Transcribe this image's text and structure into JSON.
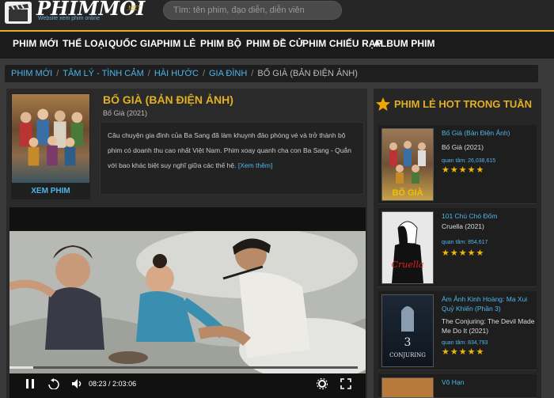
{
  "header": {
    "logo_text": "PHIMMOI",
    "logo_tagline": "Website xem phim online",
    "logo_tld": ".NET",
    "search_placeholder": "Tìm: tên phim, đạo diễn, diễn viên"
  },
  "nav": [
    "PHIM MỚI",
    "THỂ LOẠI",
    "QUỐC GIA",
    "PHIM LẺ",
    "PHIM BỘ",
    "PHIM ĐỀ CỬ",
    "PHIM CHIẾU RẠP",
    "ALBUM PHIM"
  ],
  "breadcrumb": {
    "links": [
      "PHIM MỚI",
      "TÂM LÝ - TÌNH CẢM",
      "HÀI HƯỚC",
      "GIA ĐÌNH"
    ],
    "current": "BỐ GIÀ (BẢN ĐIỆN ẢNH)"
  },
  "movie": {
    "title": "BỐ GIÀ (BẢN ĐIỆN ẢNH)",
    "subtitle": "Bố Già (2021)",
    "description": "Câu chuyện gia đình của Ba Sang đã làm khuynh đảo phòng vé và trở thành bộ phim có doanh thu cao nhất Việt Nam. Phim xoay quanh cha con Ba Sang - Quắn với bao khác biệt suy nghĩ giữa các thế hệ.",
    "more_label": "[Xem thêm]",
    "watch_label": "XEM PHIM"
  },
  "player": {
    "current_time": "08:23",
    "duration": "2:03:06",
    "progress_fraction": 0.068
  },
  "sidebar": {
    "title": "PHIM LẺ HOT TRONG TUẦN",
    "items": [
      {
        "title": "Bố Già (Bản Điện Ảnh)",
        "subtitle": "Bố Già (2021)",
        "views_label": "quan tâm:",
        "views": "26,038,615",
        "rating": "★★★★★"
      },
      {
        "title": "101 Chú Chó Đốm",
        "subtitle": "Cruella (2021)",
        "views_label": "quan tâm:",
        "views": "854,617",
        "rating": "★★★★★"
      },
      {
        "title": "Ám Ảnh Kinh Hoàng: Ma Xui Quỷ Khiến (Phần 3)",
        "subtitle": "The Conjuring: The Devil Made Me Do It (2021)",
        "views_label": "quan tâm:",
        "views": "834,793",
        "rating": "★★★★★"
      },
      {
        "title": "Vô Hạn",
        "subtitle": "",
        "views_label": "",
        "views": "",
        "rating": ""
      }
    ],
    "poster_texts": [
      "BỐ GIÀ",
      "Cruella",
      "CONJURING"
    ]
  },
  "colors": {
    "accent_yellow": "#e2b021",
    "link_blue": "#4db7ea",
    "star": "#f0b800"
  }
}
